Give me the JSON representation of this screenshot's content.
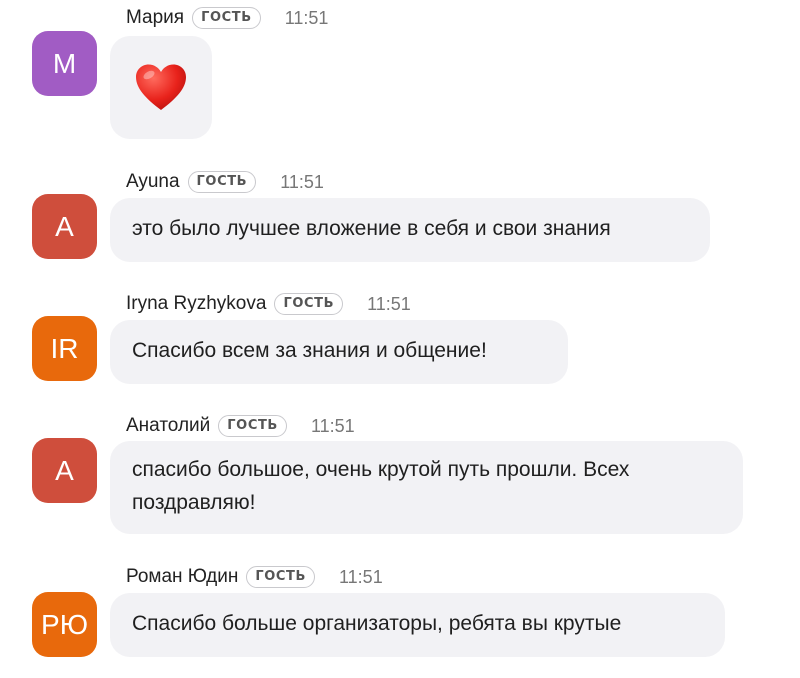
{
  "messages": [
    {
      "sender": "Мария",
      "badge": "ГОСТЬ",
      "time": "11:51",
      "avatar_initials": "M",
      "avatar_color": "#a15cc4",
      "text": "",
      "emoji": "heart-icon"
    },
    {
      "sender": "Ayuna",
      "badge": "ГОСТЬ",
      "time": "11:51",
      "avatar_initials": "A",
      "avatar_color": "#cf4e3c",
      "text": "это было лучшее вложение в себя и свои знания"
    },
    {
      "sender": "Iryna Ryzhykova",
      "badge": "ГОСТЬ",
      "time": "11:51",
      "avatar_initials": "IR",
      "avatar_color": "#e8690c",
      "text": "Спасибо всем за знания и общение!"
    },
    {
      "sender": "Анатолий",
      "badge": "ГОСТЬ",
      "time": "11:51",
      "avatar_initials": "A",
      "avatar_color": "#cf4e3c",
      "text": "спасибо большое, очень крутой путь прошли. Всех поздравляю!"
    },
    {
      "sender": "Роман Юдин",
      "badge": "ГОСТЬ",
      "time": "11:51",
      "avatar_initials": "РЮ",
      "avatar_color": "#e8690c",
      "text": "Спасибо больше организаторы, ребята вы крутые"
    }
  ]
}
